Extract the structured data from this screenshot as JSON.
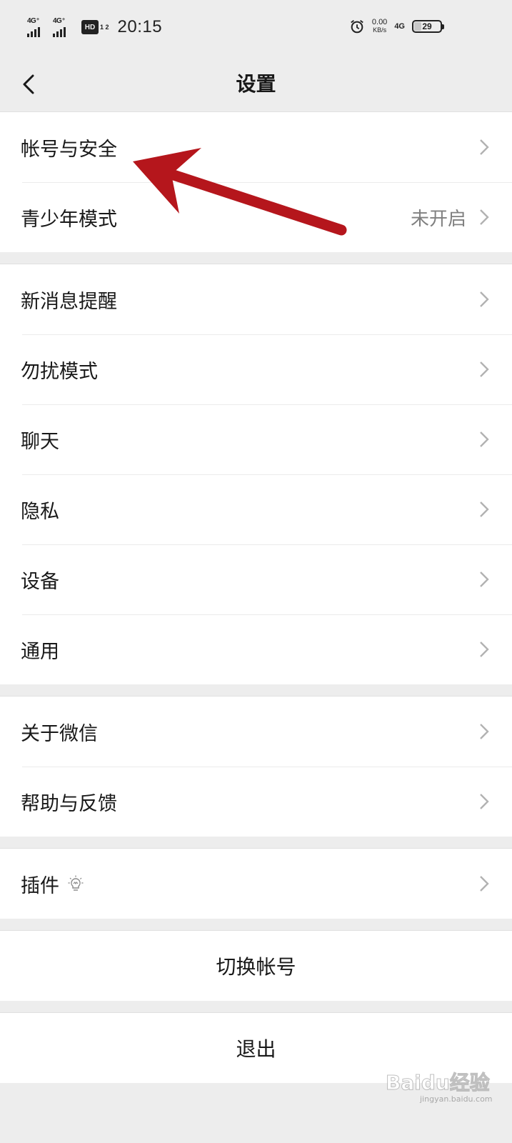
{
  "status_bar": {
    "sim1": "4G⁺",
    "sim2": "4G⁺",
    "hd": "HD",
    "hd_sub": "1 2",
    "time": "20:15",
    "speed_value": "0.00",
    "speed_unit": "KB/s",
    "net": "4G",
    "battery": "29"
  },
  "nav": {
    "title": "设置"
  },
  "groups": [
    [
      {
        "label": "帐号与安全",
        "value": ""
      },
      {
        "label": "青少年模式",
        "value": "未开启"
      }
    ],
    [
      {
        "label": "新消息提醒",
        "value": ""
      },
      {
        "label": "勿扰模式",
        "value": ""
      },
      {
        "label": "聊天",
        "value": ""
      },
      {
        "label": "隐私",
        "value": ""
      },
      {
        "label": "设备",
        "value": ""
      },
      {
        "label": "通用",
        "value": ""
      }
    ],
    [
      {
        "label": "关于微信",
        "value": ""
      },
      {
        "label": "帮助与反馈",
        "value": ""
      }
    ],
    [
      {
        "label": "插件",
        "value": ""
      }
    ]
  ],
  "actions": {
    "switch_account": "切换帐号",
    "logout": "退出"
  },
  "watermark": {
    "brand": "Baidu经验",
    "url": "jingyan.baidu.com"
  },
  "colors": {
    "background": "#ededed",
    "annotation_arrow": "#b5161c",
    "secondary_text": "#808080"
  }
}
